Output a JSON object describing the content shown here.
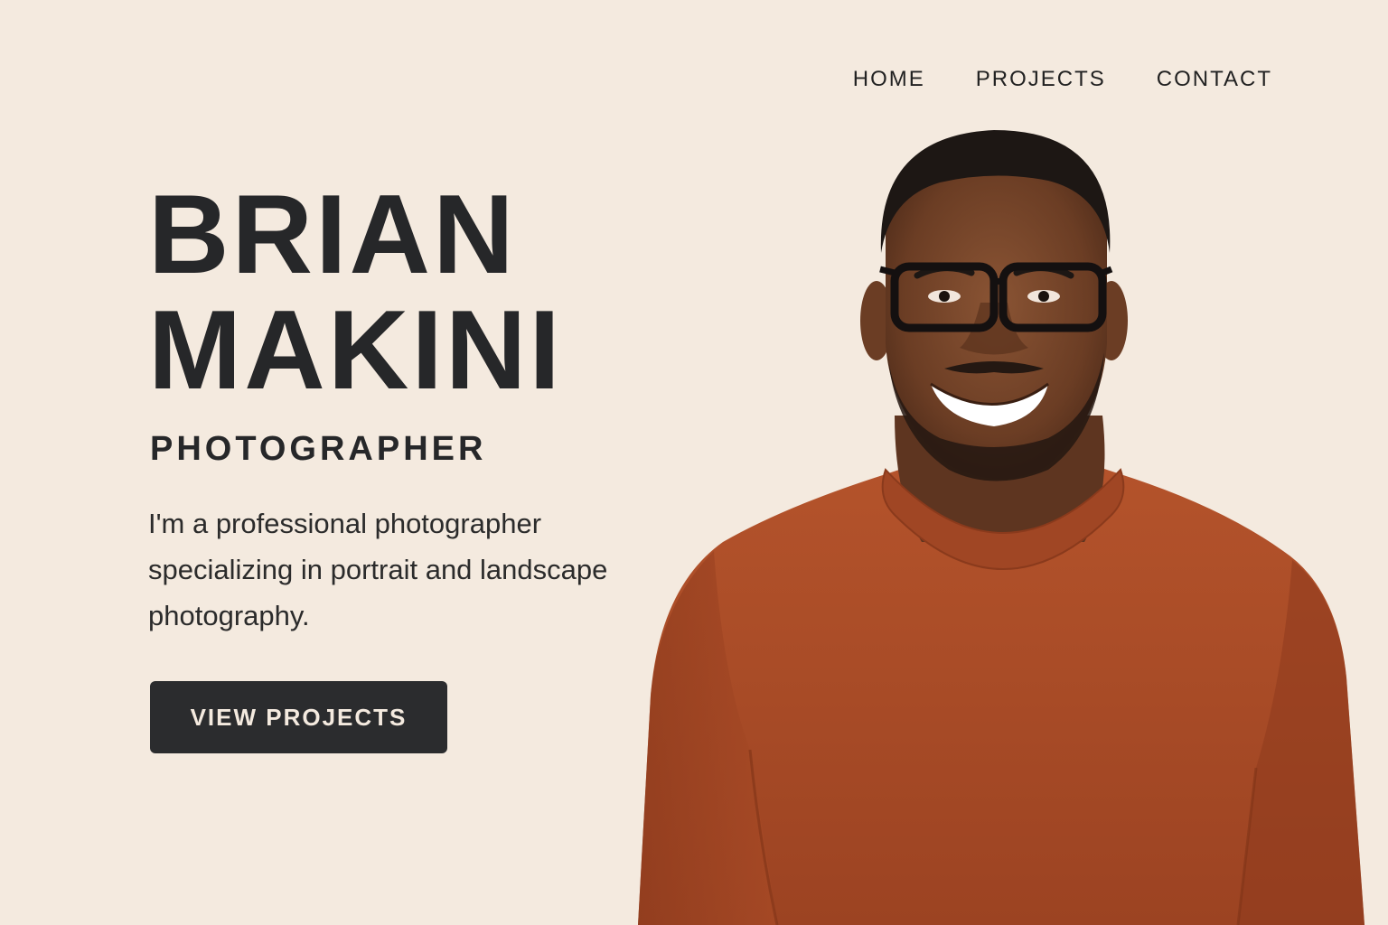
{
  "nav": {
    "items": [
      {
        "label": "HOME"
      },
      {
        "label": "PROJECTS"
      },
      {
        "label": "CONTACT"
      }
    ]
  },
  "hero": {
    "first_name": "BRIAN",
    "last_name": "MAKINI",
    "role": "PHOTOGRAPHER",
    "description": "I'm a professional photographer specializing in portrait and landscape photography.",
    "cta_label": "VIEW PROJECTS"
  },
  "colors": {
    "background": "#f4eadf",
    "text": "#262729",
    "button_bg": "#2b2c2e",
    "button_text": "#f4eadf",
    "sweater": "#a84a26"
  }
}
